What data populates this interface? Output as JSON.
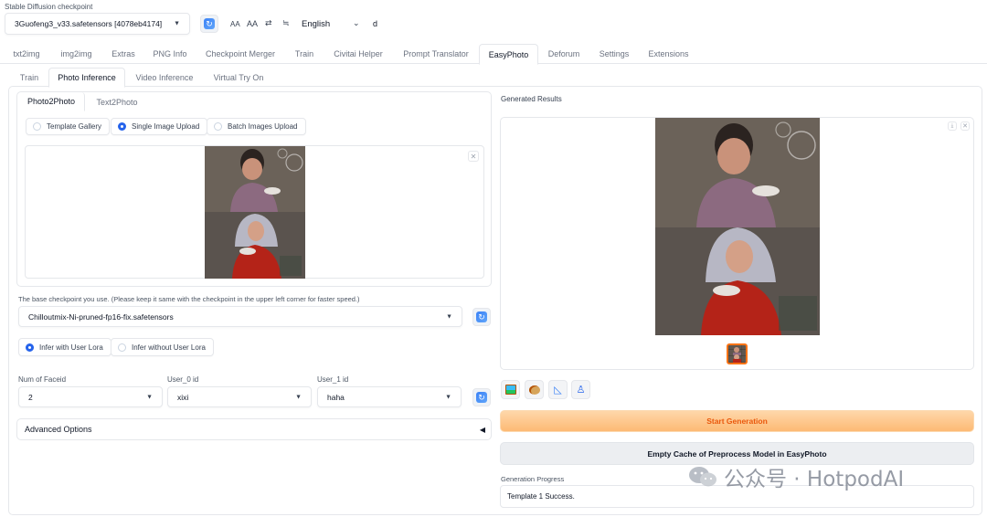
{
  "checkpoint": {
    "label": "Stable Diffusion checkpoint",
    "value": "3Guofeng3_v33.safetensors [4078eb4174]"
  },
  "topbar": {
    "font_small": "AA",
    "font_large": "AA",
    "language": "English",
    "extra": "d"
  },
  "main_tabs": [
    "txt2img",
    "img2img",
    "Extras",
    "PNG Info",
    "Checkpoint Merger",
    "Train",
    "Civitai Helper",
    "Prompt Translator",
    "EasyPhoto",
    "Deforum",
    "Settings",
    "Extensions"
  ],
  "sub_tabs": [
    "Train",
    "Photo Inference",
    "Video Inference",
    "Virtual Try On"
  ],
  "mode_tabs": [
    "Photo2Photo",
    "Text2Photo"
  ],
  "upload_modes": {
    "options": [
      "Template Gallery",
      "Single Image Upload",
      "Batch Images Upload"
    ],
    "selected": "Single Image Upload"
  },
  "base_checkpoint": {
    "label": "The base checkpoint you use. (Please keep it same with the checkpoint in the upper left corner for faster speed.)",
    "value": "Chilloutmix-Ni-pruned-fp16-fix.safetensors"
  },
  "lora": {
    "options": [
      "Infer with User Lora",
      "Infer without User Lora"
    ],
    "selected": "Infer with User Lora"
  },
  "faceid": {
    "num_label": "Num of Faceid",
    "num_value": "2",
    "user0_label": "User_0 id",
    "user0_value": "xixi",
    "user1_label": "User_1 id",
    "user1_value": "haha"
  },
  "advanced": {
    "label": "Advanced Options",
    "arrow": "◀"
  },
  "results": {
    "label": "Generated Results"
  },
  "buttons": {
    "start": "Start Generation",
    "empty_cache": "Empty Cache of Preprocess Model in EasyPhoto"
  },
  "progress": {
    "label": "Generation Progress",
    "value": "Template 1 Success."
  },
  "watermark": "公众号 · HotpodAI",
  "colors": {
    "accent": "#2563eb",
    "orange": "#ea580c"
  }
}
